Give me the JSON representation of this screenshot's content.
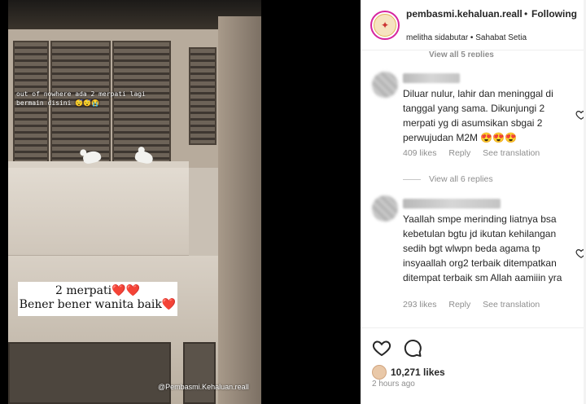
{
  "video": {
    "overlay_text": "out of nowhere ada 2 merpati lagi bermain disini 😴😴😭",
    "caption_line1": "2 merpati❤️❤️",
    "caption_line2": "Bener bener wanita baik❤️",
    "watermark": "@Pembasmi.Kehaluan.reall"
  },
  "header": {
    "username": "pembasmi.kehaluan.reall",
    "separator": "•",
    "follow_label": "Following",
    "subline": "melitha sidabutar • Sahabat Setia"
  },
  "clipped_view_replies": "View all 5 replies",
  "comments": [
    {
      "text": "Diluar nulur, lahir dan meninggal di tanggal yang sama. Dikunjungi 2 merpati yg di asumsikan sbgai 2 perwujudan M2M 😍😍😍",
      "likes": "409 likes",
      "reply": "Reply",
      "translate": "See translation",
      "view_replies": "View all 6 replies"
    },
    {
      "text": "Yaallah smpe merinding liatnya bsa kebetulan bgtu jd ikutan kehilangan sedih bgt wlwpn beda agama tp insyaallah org2 terbaik ditempatkan ditempat terbaik sm Allah aamiiin yra",
      "likes": "293 likes",
      "reply": "Reply",
      "translate": "See translation"
    }
  ],
  "actions": {
    "like_count": "10,271 likes",
    "time": "2 hours ago"
  },
  "icons": {
    "heart": "heart-icon",
    "comment": "comment-icon",
    "avatar": "profile-avatar"
  },
  "colors": {
    "text": "#262626",
    "muted": "#8e8e8e",
    "avatar_ring": "#d6249f"
  }
}
